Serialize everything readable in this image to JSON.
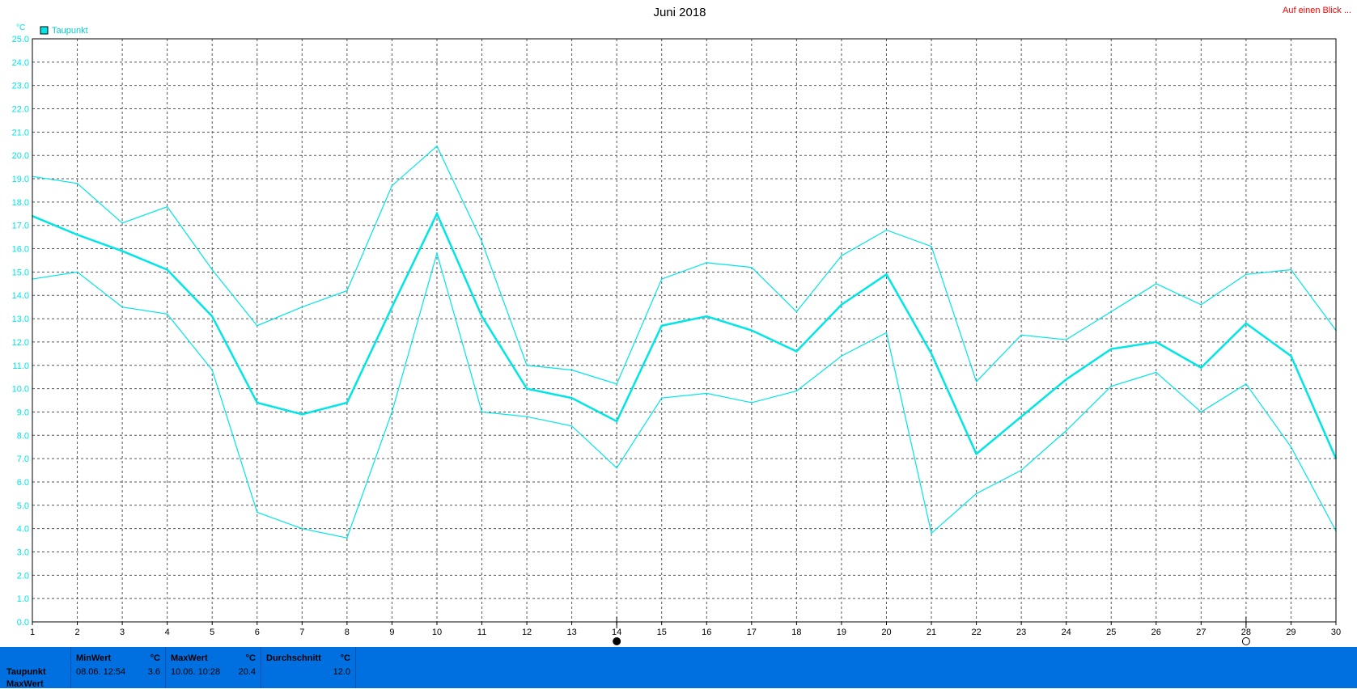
{
  "header": {
    "title": "Juni 2018",
    "link": "Auf einen Blick ..."
  },
  "colors": {
    "series": "#00e5e5",
    "stats_bg": "#0070e0",
    "link": "#ff0000"
  },
  "chart_data": {
    "type": "line",
    "title": "Juni 2018",
    "ylabel": "°C",
    "ylim": [
      0,
      25
    ],
    "y_step": 1,
    "xlim": [
      1,
      30
    ],
    "x": [
      1,
      2,
      3,
      4,
      5,
      6,
      7,
      8,
      9,
      10,
      11,
      12,
      13,
      14,
      15,
      16,
      17,
      18,
      19,
      20,
      21,
      22,
      23,
      24,
      25,
      26,
      27,
      28,
      29,
      30
    ],
    "legend": [
      "Taupunkt"
    ],
    "legend_position": "top-left",
    "grid": true,
    "markers": [
      {
        "day": 14,
        "symbol": "full-moon"
      },
      {
        "day": 28,
        "symbol": "new-moon"
      }
    ],
    "series": [
      {
        "name": "Taupunkt",
        "role": "max",
        "values": [
          19.1,
          18.8,
          17.1,
          17.8,
          15.1,
          12.7,
          13.5,
          14.2,
          18.7,
          20.4,
          16.3,
          11.0,
          10.8,
          10.2,
          14.7,
          15.4,
          15.2,
          13.3,
          15.7,
          16.8,
          16.1,
          10.3,
          12.3,
          12.1,
          13.3,
          14.5,
          13.6,
          14.9,
          15.1,
          12.5
        ]
      },
      {
        "role": "avg",
        "values": [
          17.4,
          16.6,
          15.9,
          15.1,
          13.1,
          9.4,
          8.9,
          9.4,
          13.5,
          17.5,
          13.1,
          10.0,
          9.6,
          8.6,
          12.7,
          13.1,
          12.5,
          11.6,
          13.6,
          14.9,
          11.5,
          7.2,
          8.8,
          10.4,
          11.7,
          12.0,
          10.9,
          12.8,
          11.4,
          7.0
        ]
      },
      {
        "role": "min",
        "values": [
          14.7,
          15.0,
          13.5,
          13.2,
          10.8,
          4.7,
          4.0,
          3.6,
          9.0,
          15.8,
          9.0,
          8.8,
          8.4,
          6.6,
          9.6,
          9.8,
          9.4,
          9.9,
          11.4,
          12.4,
          3.8,
          5.5,
          6.5,
          8.2,
          10.1,
          10.7,
          9.0,
          10.2,
          7.5,
          3.9
        ]
      }
    ]
  },
  "stats": {
    "row_label": "Taupunkt",
    "row_label_2": "MaxWert",
    "min": {
      "header": "MinWert",
      "unit": "°C",
      "date": "08.06.  12:54",
      "value": "3.6"
    },
    "max": {
      "header": "MaxWert",
      "unit": "°C",
      "date": "10.06.  10:28",
      "value": "20.4"
    },
    "avg": {
      "header": "Durchschnitt",
      "unit": "°C",
      "value": "12.0"
    }
  }
}
